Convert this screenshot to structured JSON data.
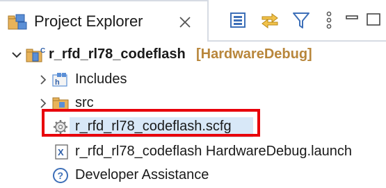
{
  "panel": {
    "tab_title": "Project Explorer",
    "tab_icon": "project-explorer-icon",
    "close_icon": "close-icon"
  },
  "toolbar": {
    "buttons": [
      {
        "name": "collapse-all-icon"
      },
      {
        "name": "link-with-editor-icon"
      },
      {
        "name": "filter-icon"
      },
      {
        "name": "view-menu-icon"
      },
      {
        "name": "minimize-icon"
      },
      {
        "name": "maximize-icon"
      }
    ]
  },
  "tree": {
    "project": {
      "label": "r_rfd_rl78_codeflash",
      "tag": "[HardwareDebug]",
      "expanded": true
    },
    "items": [
      {
        "label": "Includes",
        "icon": "includes-folder-icon",
        "expandable": true
      },
      {
        "label": "src",
        "icon": "source-folder-icon",
        "expandable": true
      },
      {
        "label": "r_rfd_rl78_codeflash.scfg",
        "icon": "gear-file-icon",
        "expandable": false,
        "selected": true
      },
      {
        "label": "r_rfd_rl78_codeflash HardwareDebug.launch",
        "icon": "launch-file-icon",
        "expandable": false
      },
      {
        "label": "Developer Assistance",
        "icon": "help-icon",
        "expandable": false
      }
    ]
  },
  "colors": {
    "highlight_border": "#e8000b",
    "selection": "#d8e8f8",
    "project_tag": "#b8863b"
  }
}
